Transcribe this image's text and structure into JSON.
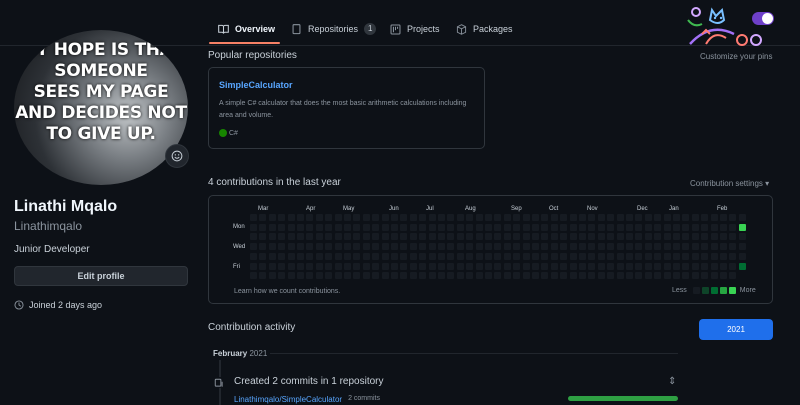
{
  "nav": {
    "tabs": [
      {
        "label": "Overview",
        "icon": "book-icon",
        "active": true
      },
      {
        "label": "Repositories",
        "icon": "repo-icon",
        "count": "1"
      },
      {
        "label": "Projects",
        "icon": "project-icon"
      },
      {
        "label": "Packages",
        "icon": "package-icon"
      }
    ]
  },
  "profile": {
    "avatar_text": [
      "MY HOPE IS THAT",
      "SOMEONE",
      "SEES MY PAGE",
      "AND DECIDES NOT",
      "TO GIVE UP."
    ],
    "full_name": "Linathi Mqalo",
    "username": "Linathimqalo",
    "bio": "Junior Developer",
    "edit_label": "Edit profile",
    "joined": "Joined 2 days ago"
  },
  "popular": {
    "title": "Popular repositories",
    "customize": "Customize your pins",
    "repo": {
      "name": "SimpleCalculator",
      "description": "A simple C# calculator that does the most basic arithmetic calculations including area and volume.",
      "language": "C#",
      "language_color": "#178600"
    }
  },
  "contributions": {
    "title": "4 contributions in the last year",
    "settings": "Contribution settings ▾",
    "months": [
      "Mar",
      "Apr",
      "May",
      "Jun",
      "Jul",
      "Aug",
      "Sep",
      "Oct",
      "Nov",
      "Dec",
      "Jan",
      "Feb"
    ],
    "days": [
      "Mon",
      "Wed",
      "Fri"
    ],
    "learn": "Learn how we count contributions.",
    "less": "Less",
    "more": "More",
    "colors": {
      "empty": "#161b22",
      "l1": "#0e4429",
      "l2": "#006d32",
      "l3": "#26a641",
      "l4": "#39d353"
    }
  },
  "activity": {
    "title": "Contribution activity",
    "year": "2021",
    "month": "February",
    "month_year": "2021",
    "commit_title": "Created 2 commits in 1 repository",
    "repo": "Linathimqalo/SimpleCalculator",
    "commit_count": "2 commits"
  }
}
